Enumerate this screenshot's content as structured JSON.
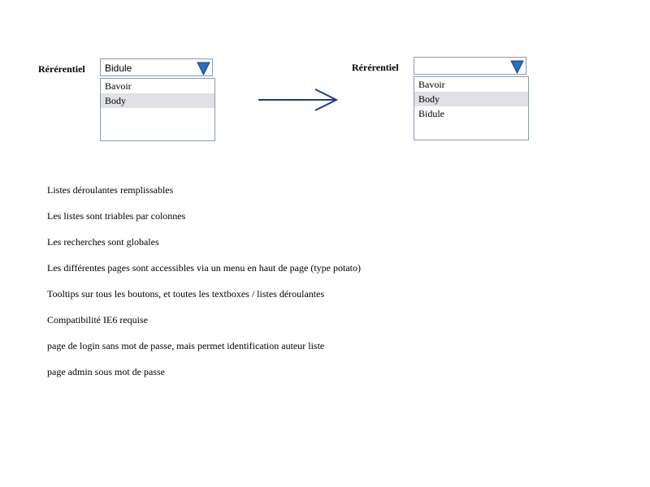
{
  "colors": {
    "accent": "#2b6cc4",
    "border": "#8a9ab0",
    "arrow": "#1f3a8a",
    "selected_bg": "#e0e0e6"
  },
  "before": {
    "label": "Rérérentiel",
    "combo_value": "Bidule",
    "arrow_icon": "triangle-down-icon",
    "items": [
      {
        "text": "Bavoir",
        "selected": false
      },
      {
        "text": "Body",
        "selected": true
      }
    ]
  },
  "after": {
    "label": "Rérérentiel",
    "combo_value": "",
    "arrow_icon": "triangle-down-icon",
    "items": [
      {
        "text": "Bavoir",
        "selected": false
      },
      {
        "text": "Body",
        "selected": true
      },
      {
        "text": "Bidule",
        "selected": false
      }
    ]
  },
  "transition_icon": "arrow-right-icon",
  "notes": [
    "Listes déroulantes remplissables",
    "Les listes sont triables par colonnes",
    "Les recherches sont globales",
    "Les différentes pages sont accessibles via un menu en haut de page (type potato)",
    "Tooltips sur tous les boutons, et toutes les textboxes / listes déroulantes",
    "Compatibilité IE6 requise",
    "page de login sans mot de passe, mais permet identification auteur liste",
    "page admin sous mot de passe"
  ]
}
